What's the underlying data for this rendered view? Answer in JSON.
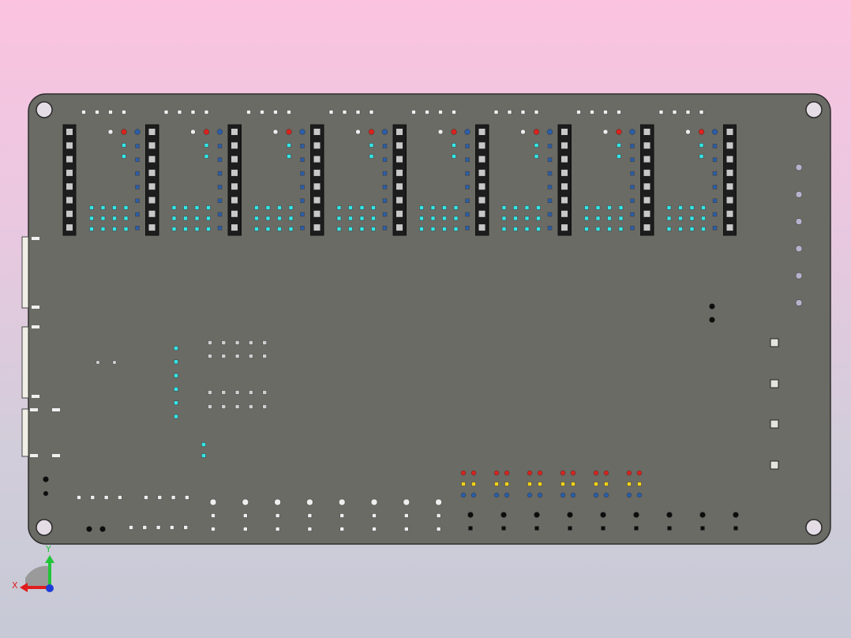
{
  "viewer": {
    "background_top": "#fbc3df",
    "background_bottom": "#c7c9d6"
  },
  "board": {
    "color": "#6b6b65",
    "edge_color": "#2e2e2e",
    "digit_modules": 8,
    "connector_groups": 6
  },
  "colors": {
    "cyan_pad": "#35e6e6",
    "blue_pad": "#2a5ea8",
    "red_pad": "#d9231e",
    "yellow_pad": "#f0d21a",
    "black_pad": "#0d0d0d",
    "white_pad": "#eeeeee",
    "connector": "#e4e4dc",
    "mount_hole": "#e5dde6"
  },
  "triad": {
    "x_label": "X",
    "y_label": "Y",
    "x_color": "#e01c1c",
    "y_color": "#22c43a",
    "origin_color": "#1f3dd6"
  }
}
